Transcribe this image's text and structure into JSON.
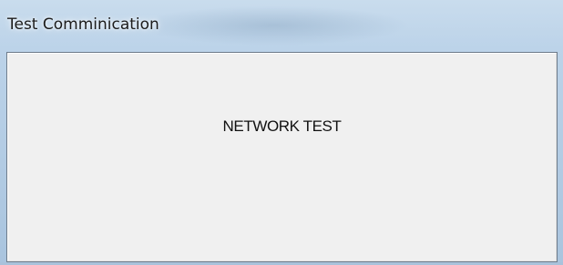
{
  "window": {
    "title": "Test Comminication"
  },
  "content": {
    "label": "NETWORK TEST"
  },
  "colors": {
    "titlebar_glass": "#bcd3e9",
    "client_background": "#f0f0f0",
    "client_border": "#6d7b8a",
    "text": "#111111"
  }
}
